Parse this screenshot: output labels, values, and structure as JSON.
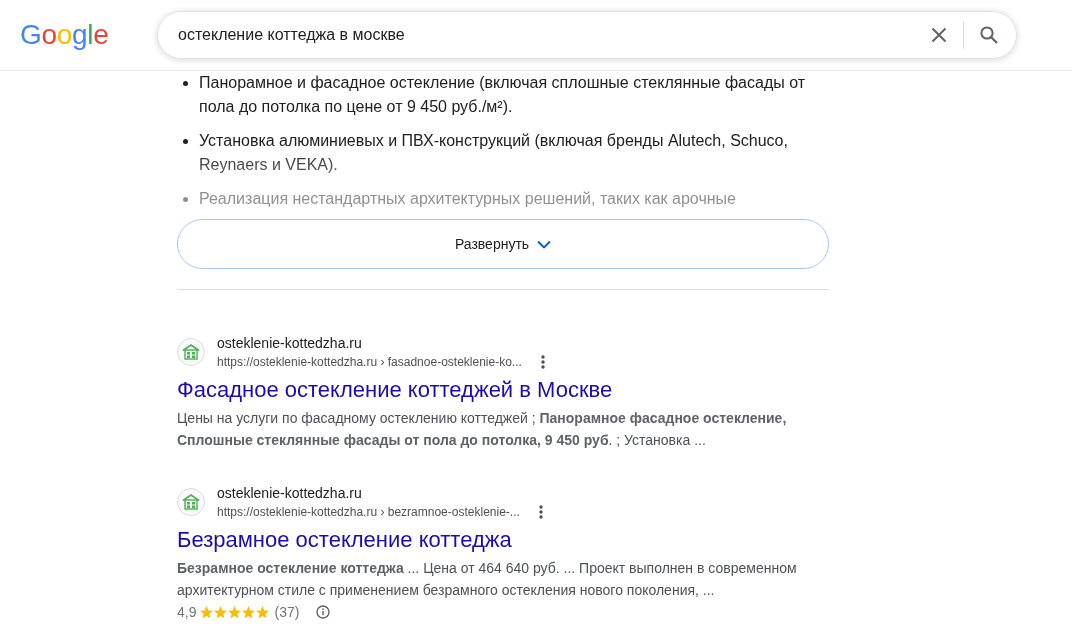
{
  "header": {
    "logo": "Google",
    "search": {
      "value": "остекление коттеджа в москве"
    }
  },
  "overview": {
    "expanded": false,
    "items": [
      "Панорамное и фасадное остекление (включая сплошные стеклянные фасады от пола до потолка по цене от 9 450 руб./м²).",
      "Установка алюминиевых и ПВХ-конструкций (включая бренды Alutech, Schuco, Reynaers и VEKA).",
      "Реализация нестандартных архитектурных решений, таких как арочные"
    ],
    "expand_button": "Развернуть"
  },
  "results": [
    {
      "site_name": "osteklenie-kottedzha.ru",
      "url": "https://osteklenie-kottedzha.ru › fasadnoe-osteklenie-ko...",
      "title": "Фасадное остекление коттеджей в Москве",
      "snippet": "Цены на услуги по фасадному остеклению коттеджей ; **Панорамное фасадное остекление, Сплошные стеклянные фасады от пола до потолка, 9 450 руб**. ; Установка ..."
    },
    {
      "site_name": "osteklenie-kottedzha.ru",
      "url": "https://osteklenie-kottedzha.ru › bezramnoe-osteklenie-...",
      "title": "Безрамное остекление коттеджа",
      "snippet": "**Безрамное остекление коттеджа** ... Цена от 464 640 руб. ... Проект выполнен в современном архитектурном стиле с применением безрамного остекления нового поколения, ...",
      "rating": {
        "score": "4,9",
        "stars": 5,
        "count": "(37)"
      }
    }
  ]
}
